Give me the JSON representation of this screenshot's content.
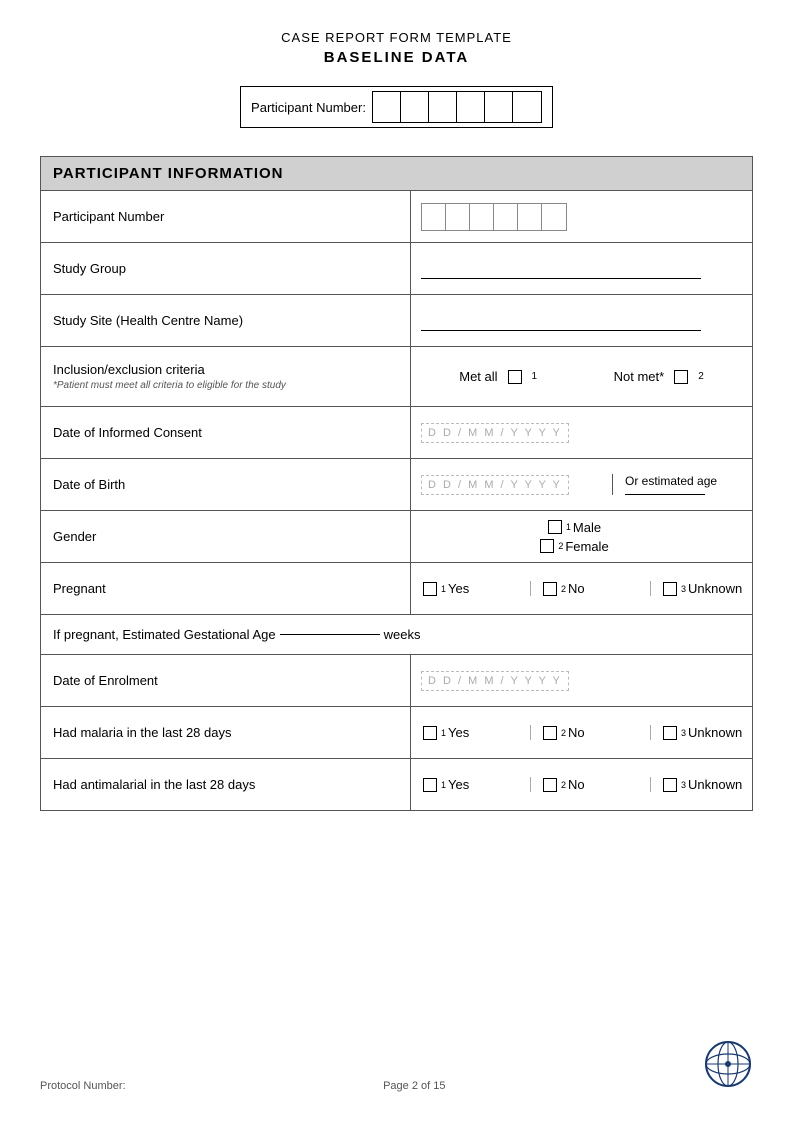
{
  "page": {
    "title": "CASE REPORT FORM TEMPLATE",
    "subtitle": "BASELINE DATA",
    "participant_number_label": "Participant Number:",
    "participant_boxes_count": 6
  },
  "section": {
    "title": "PARTICIPANT INFORMATION",
    "rows": [
      {
        "id": "participant-number",
        "label": "Participant Number",
        "type": "boxes"
      },
      {
        "id": "study-group",
        "label": "Study Group",
        "type": "underline"
      },
      {
        "id": "study-site",
        "label": "Study Site (Health Centre Name)",
        "type": "underline"
      },
      {
        "id": "inclusion-exclusion",
        "label": "Inclusion/exclusion criteria",
        "sublabel": "*Patient must meet all criteria to eligible for the study",
        "type": "inclusion",
        "met_all": "Met all",
        "not_met": "Not met*"
      },
      {
        "id": "date-informed-consent",
        "label": "Date of Informed Consent",
        "type": "date"
      },
      {
        "id": "date-of-birth",
        "label": "Date of Birth",
        "type": "date-with-estimated",
        "estimated_label": "Or estimated age"
      },
      {
        "id": "gender",
        "label": "Gender",
        "type": "gender",
        "options": [
          {
            "num": "1",
            "text": "Male"
          },
          {
            "num": "2",
            "text": "Female"
          }
        ]
      },
      {
        "id": "pregnant",
        "label": "Pregnant",
        "type": "three-options",
        "options": [
          {
            "num": "1",
            "text": "Yes"
          },
          {
            "num": "2",
            "text": "No"
          },
          {
            "num": "3",
            "text": "Unknown"
          }
        ]
      },
      {
        "id": "gestational-age",
        "label": "If pregnant, Estimated Gestational Age",
        "suffix": "weeks",
        "type": "full-width-text"
      },
      {
        "id": "date-enrolment",
        "label": "Date of Enrolment",
        "type": "date"
      },
      {
        "id": "had-malaria",
        "label": "Had malaria in the last 28 days",
        "type": "three-options",
        "options": [
          {
            "num": "1",
            "text": "Yes"
          },
          {
            "num": "2",
            "text": "No"
          },
          {
            "num": "3",
            "text": "Unknown"
          }
        ]
      },
      {
        "id": "had-antimalarial",
        "label": "Had antimalarial in the last 28 days",
        "type": "three-options",
        "options": [
          {
            "num": "1",
            "text": "Yes"
          },
          {
            "num": "2",
            "text": "No"
          },
          {
            "num": "3",
            "text": "Unknown"
          }
        ]
      }
    ]
  },
  "footer": {
    "protocol_label": "Protocol Number:",
    "page_info": "Page 2 of 15"
  }
}
